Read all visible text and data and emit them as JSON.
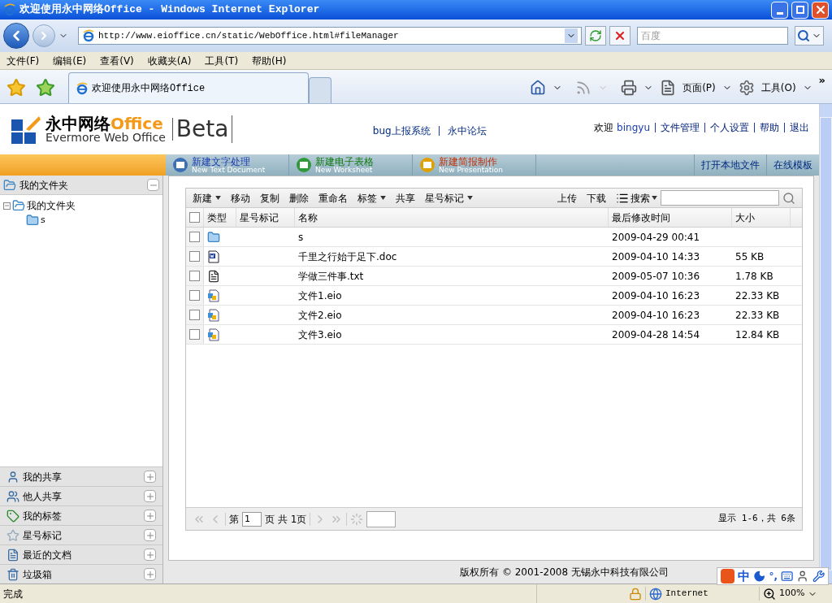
{
  "window": {
    "title": "欢迎使用永中网络Office - Windows Internet Explorer"
  },
  "address_bar": {
    "url": "http://www.eioffice.cn/static/WebOffice.html#fileManager",
    "search_placeholder": "百度"
  },
  "menu": [
    "文件(F)",
    "编辑(E)",
    "查看(V)",
    "收藏夹(A)",
    "工具(T)",
    "帮助(H)"
  ],
  "tabs": [
    {
      "label": "欢迎使用永中网络Office",
      "selected": true
    }
  ],
  "command_bar": {
    "page": "页面(P)",
    "tools": "工具(O)",
    "more": "»"
  },
  "header": {
    "logo_cn": "永中网络",
    "logo_office": "Office",
    "logo_en": "Evermore Web Office",
    "logo_beta": "Beta",
    "links": [
      "bug上报系统",
      "永中论坛"
    ],
    "welcome": "欢迎",
    "user": "bingyu",
    "user_links": [
      "文件管理",
      "个人设置",
      "帮助",
      "退出"
    ]
  },
  "nav": {
    "create": [
      {
        "kind": "text",
        "title": "新建文字处理",
        "subtitle": "New Text Document"
      },
      {
        "kind": "sheet",
        "title": "新建电子表格",
        "subtitle": "New Worksheet"
      },
      {
        "kind": "presentation",
        "title": "新建简报制作",
        "subtitle": "New Presentation"
      }
    ],
    "right": [
      "打开本地文件",
      "在线模板"
    ]
  },
  "sidebar": {
    "header": {
      "label": "我的文件夹",
      "expanded": true
    },
    "tree": [
      {
        "label": "我的文件夹",
        "expanded": true,
        "children": [
          {
            "label": "s"
          }
        ]
      }
    ],
    "sections": [
      {
        "kind": "share",
        "label": "我的共享",
        "expanded": false
      },
      {
        "kind": "others",
        "label": "他人共享",
        "expanded": false
      },
      {
        "kind": "tag",
        "label": "我的标签",
        "expanded": false
      },
      {
        "kind": "star",
        "label": "星号标记",
        "expanded": false
      },
      {
        "kind": "recent",
        "label": "最近的文档",
        "expanded": false
      },
      {
        "kind": "trash",
        "label": "垃圾箱",
        "expanded": false
      }
    ]
  },
  "file_toolbar": {
    "left": [
      {
        "label": "新建",
        "dropdown": true
      },
      {
        "label": "移动",
        "dropdown": false
      },
      {
        "label": "复制",
        "dropdown": false
      },
      {
        "label": "删除",
        "dropdown": false
      },
      {
        "label": "重命名",
        "dropdown": false
      },
      {
        "label": "标签",
        "dropdown": true
      },
      {
        "label": "共享",
        "dropdown": false
      },
      {
        "label": "星号标记",
        "dropdown": true
      }
    ],
    "right": [
      {
        "label": "上传",
        "dropdown": false
      },
      {
        "label": "下载",
        "dropdown": false
      }
    ],
    "search": "搜索"
  },
  "table": {
    "select_all": {
      "checked": false
    },
    "columns": [
      "类型",
      "星号标记",
      "名称",
      "最后修改时间",
      "大小"
    ],
    "rows": [
      {
        "kind": "folder",
        "name": "s",
        "modified": "2009-04-29 00:41",
        "size": "",
        "checked": false
      },
      {
        "kind": "doc",
        "name": "千里之行始于足下.doc",
        "modified": "2009-04-10 14:33",
        "size": "55 KB",
        "checked": false
      },
      {
        "kind": "txt",
        "name": "学做三件事.txt",
        "modified": "2009-05-07 10:36",
        "size": "1.78 KB",
        "checked": false
      },
      {
        "kind": "eio",
        "name": "文件1.eio",
        "modified": "2009-04-10 16:23",
        "size": "22.33 KB",
        "checked": false
      },
      {
        "kind": "eio",
        "name": "文件2.eio",
        "modified": "2009-04-10 16:23",
        "size": "22.33 KB",
        "checked": false
      },
      {
        "kind": "eio",
        "name": "文件3.eio",
        "modified": "2009-04-28 14:54",
        "size": "12.84 KB",
        "checked": false
      }
    ]
  },
  "pager": {
    "before": "第",
    "page": "1",
    "middle": "页 共",
    "total": "1页",
    "summary": "显示 1-6，共 6条"
  },
  "footer": "版权所有 © 2001-2008 无锡永中科技有限公司",
  "ime": {
    "mode": "中",
    "punct": "°,"
  },
  "status_bar": {
    "text": "完成",
    "zone": "Internet",
    "zoom": "100%"
  }
}
